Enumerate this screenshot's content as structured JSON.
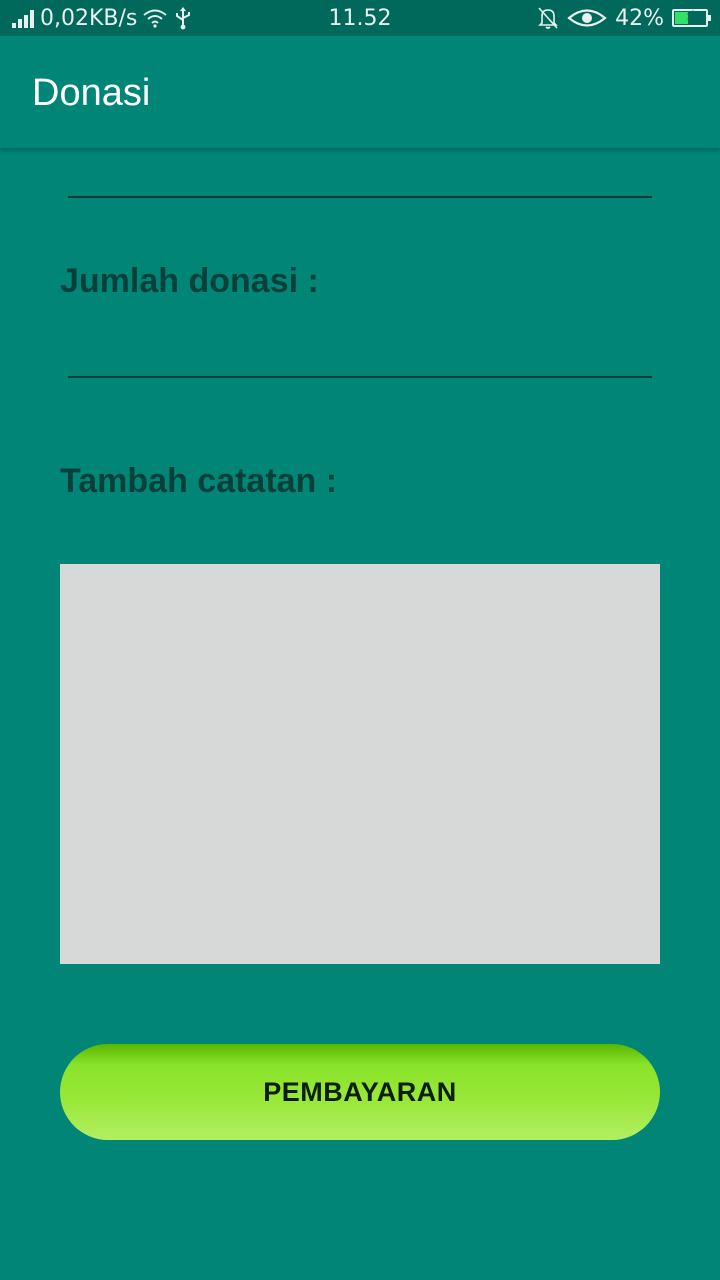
{
  "status_bar": {
    "net_speed": "0,02KB/s",
    "time": "11.52",
    "battery_percent": "42%",
    "battery_level": 0.42,
    "icons": [
      "signal-icon",
      "wifi-icon",
      "usb-icon",
      "bell-muted-icon",
      "eye-icon",
      "battery-charging-icon"
    ]
  },
  "app_bar": {
    "title": "Donasi"
  },
  "form": {
    "amount_label": "Jumlah donasi :",
    "amount_value": "",
    "note_label": "Tambah catatan :",
    "note_value": ""
  },
  "actions": {
    "pay_label": "PEMBAYARAN"
  },
  "colors": {
    "background": "#018577",
    "status_bar": "#00695c",
    "label_text": "#07403b",
    "notes_bg": "#d7d9d9",
    "button_green": "#8ae32a"
  }
}
